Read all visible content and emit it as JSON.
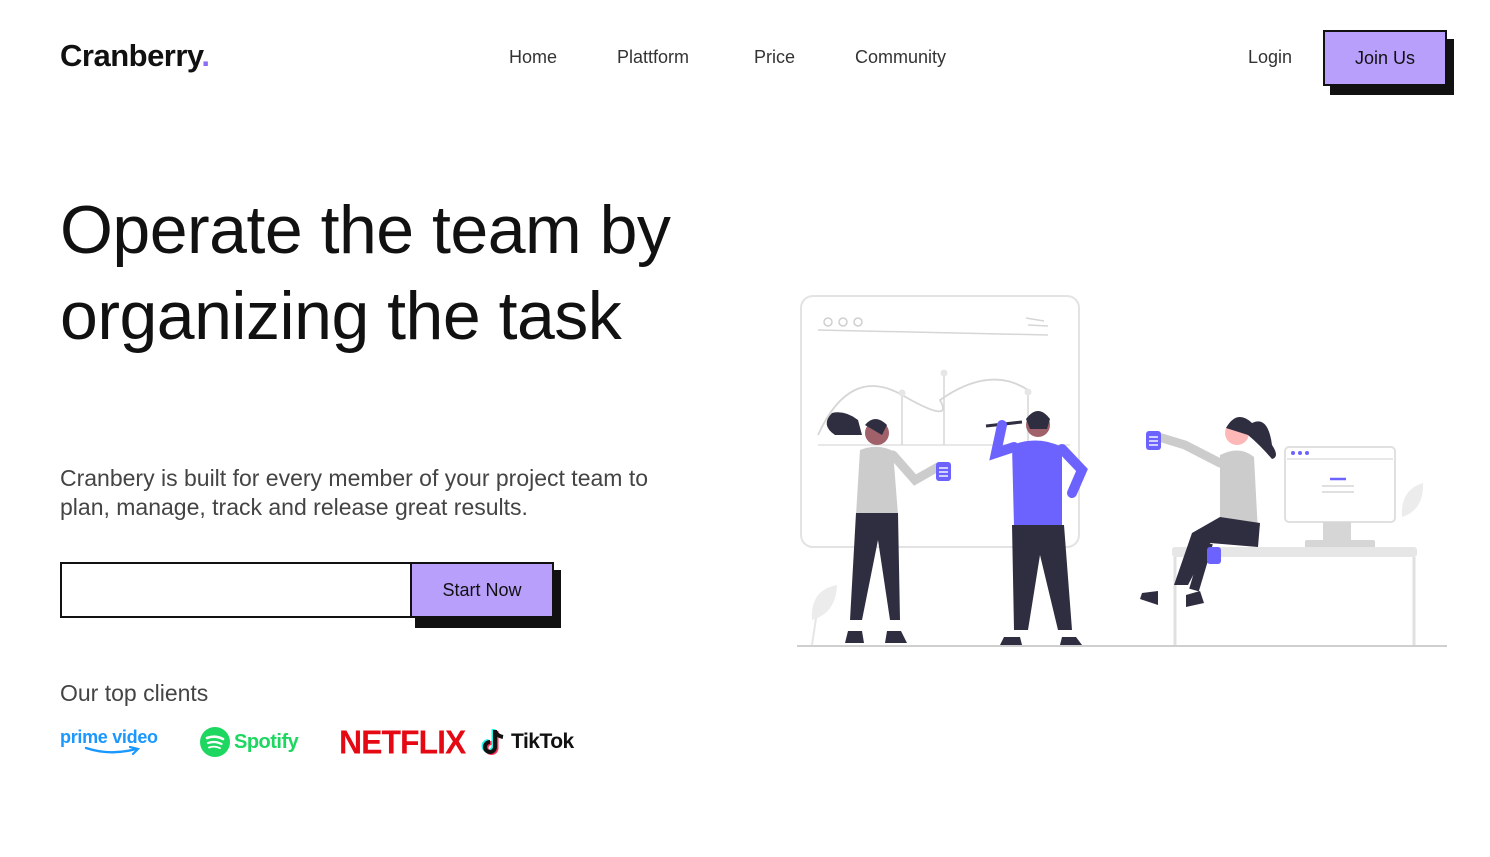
{
  "header": {
    "logo": "Cranberry",
    "logo_dot": ".",
    "nav": [
      "Home",
      "Plattform",
      "Price",
      "Community"
    ],
    "login": "Login",
    "join": "Join Us"
  },
  "hero": {
    "title": "Operate the team by organizing the task",
    "description": "Cranbery is built for every member of your project team to plan, manage, track and release great results.",
    "input_placeholder": "",
    "cta": "Start Now"
  },
  "clients": {
    "title": "Our top clients",
    "logos": [
      "prime video",
      "Spotify",
      "NETFLIX",
      "TikTok"
    ]
  },
  "colors": {
    "accent": "#b79ffb",
    "illustration_purple": "#6c63ff",
    "logo_dot": "#8b6cf6"
  }
}
